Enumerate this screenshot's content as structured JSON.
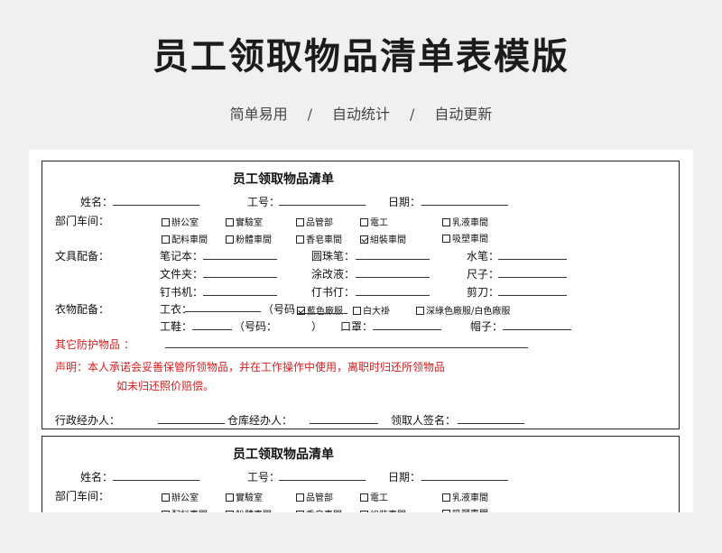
{
  "header": {
    "title": "员工领取物品清单表模版",
    "features": [
      "简单易用",
      "自动统计",
      "自动更新"
    ],
    "separator": "/"
  },
  "form": {
    "title": "员工领取物品清单",
    "name_label": "姓名：",
    "id_label": "工号：",
    "date_label": "日期：",
    "dept_label": "部门车间：",
    "dept_options": [
      {
        "label": "辦公室",
        "checked": false
      },
      {
        "label": "實驗室",
        "checked": false
      },
      {
        "label": "品管部",
        "checked": false
      },
      {
        "label": "電工",
        "checked": false
      },
      {
        "label": "乳液車間",
        "checked": false
      },
      {
        "label": "配料車間",
        "checked": false
      },
      {
        "label": "粉體車間",
        "checked": false
      },
      {
        "label": "香皂車間",
        "checked": false
      },
      {
        "label": "組裝車間",
        "checked": true
      },
      {
        "label": "吸塑車間",
        "checked": false
      }
    ],
    "stationery_label": "文具配备：",
    "stationery_items": [
      "笔记本：",
      "圆珠笔：",
      "水笔：",
      "文件夹：",
      "涂改液：",
      "尺子：",
      "钉书机：",
      "仃书仃：",
      "剪刀："
    ],
    "clothing_label": "衣物配备：",
    "work_clothes_label": "工衣：",
    "size_label_1": "（号码",
    "clothes_options": [
      {
        "label": "藍色廠服",
        "checked": true
      },
      {
        "label": "白大褂",
        "checked": false
      },
      {
        "label": "深綠色廠服/白色廠服",
        "checked": false
      }
    ],
    "shoes_label": "工鞋：",
    "size_label_2": "（号码：",
    "size_close": "）",
    "mask_label": "口罩：",
    "hat_label": "帽子：",
    "other_label": "其它防护物品 ：",
    "statement_line1": "声明：本人承诺会妥善保管所领物品，并在工作操作中使用，离职时归还所领物品",
    "statement_line2": "如未归还照价赔偿。",
    "admin_label": "行政经办人：",
    "warehouse_label": "仓库经办人：",
    "receiver_label": "领取人签名："
  }
}
